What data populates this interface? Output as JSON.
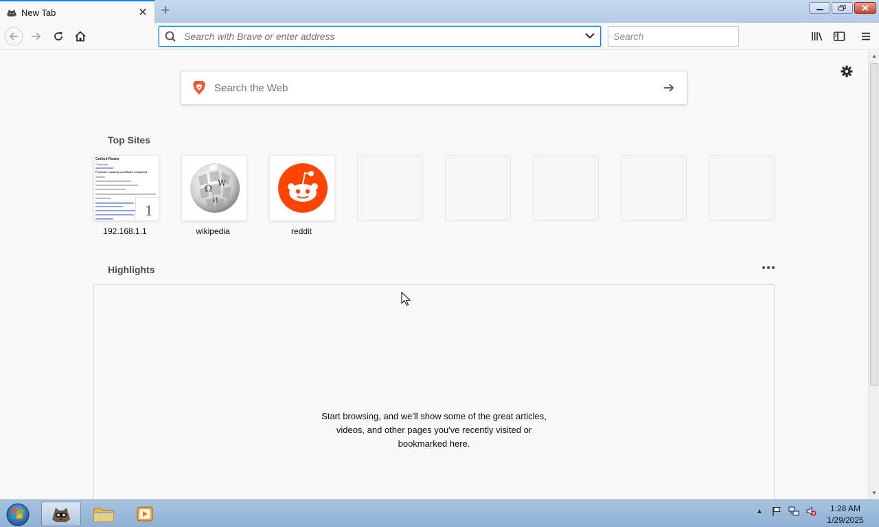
{
  "browser": {
    "tab": {
      "title": "New Tab"
    },
    "window_controls": {
      "minimize": "minimize",
      "maximize": "maximize",
      "close": "close"
    },
    "urlbar": {
      "placeholder": "Search with Brave or enter address"
    },
    "searchbar": {
      "placeholder": "Search"
    }
  },
  "newtab": {
    "web_search": {
      "placeholder": "Search the Web"
    },
    "top_sites": {
      "title": "Top Sites",
      "sites": [
        {
          "label": "192.168.1.1",
          "pin_badge": "1"
        },
        {
          "label": "wikipedia"
        },
        {
          "label": "reddit"
        }
      ],
      "thumbnail_text": {
        "heading": "Crafted Router",
        "sub": "Certificate",
        "line": "Firmware capacity certificate computed"
      }
    },
    "highlights": {
      "title": "Highlights",
      "empty_message": [
        "Start browsing, and we'll show some of the great articles,",
        "videos, and other pages you've recently visited or",
        "bookmarked here."
      ]
    }
  },
  "taskbar": {
    "clock": {
      "time": "1:28 AM",
      "date": "1/29/2025"
    }
  },
  "colors": {
    "accent": "#0a84ff",
    "brave_orange": "#fb542b",
    "reddit_orange": "#ff4500"
  }
}
